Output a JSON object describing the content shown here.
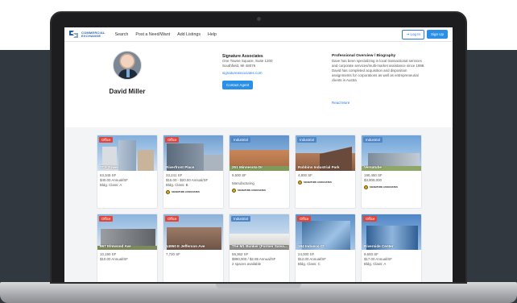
{
  "nav": {
    "logo_line1": "COMMERCIAL",
    "logo_line2": "EXCHANGE",
    "links": [
      "Search",
      "Post a Need/Want",
      "Add Listings",
      "Help"
    ],
    "login_label": "Log In",
    "signup_label": "Sign Up"
  },
  "agent": {
    "name": "David Miller",
    "company": "Signature Associates",
    "address1": "One Towne Square, Suite 1200",
    "address2": "Southfield, MI 48076",
    "website": "signatureassociates.com",
    "contact_label": "Contact Agent"
  },
  "bio": {
    "title": "Professional Overview / Biography",
    "text": "Dave has been specializing in local transactional services and corporate services/multi-market assistance since 1998. David has completed acquisition and disposition assignments for corporations as well as entrepreneurial clients in Austra",
    "read_more": "Read More"
  },
  "listings": [
    {
      "tag": "Office",
      "title": "TCF Tower",
      "lines": [
        "63,345 SF",
        "$40.00 Annual/SF",
        "Bldg. Class: A"
      ],
      "brand": false
    },
    {
      "tag": "Office",
      "title": "Riverfront Place",
      "lines": [
        "33,241 SF",
        "$15.00 - $20.00 Annual/SF",
        "Bldg. Class: B"
      ],
      "brand": true
    },
    {
      "tag": "Industrial",
      "title": "251 Minnesota Dr",
      "lines": [
        "9,500 SF",
        "",
        "Manufacturing"
      ],
      "brand": true
    },
    {
      "tag": "Industrial",
      "title": "Robbins Industrial Park",
      "lines": [
        "4,800 SF"
      ],
      "brand": true
    },
    {
      "tag": "Industrial",
      "title": "Versatube",
      "lines": [
        "190,450 SF",
        "$3,809,000"
      ],
      "brand": true
    },
    {
      "tag": "Office",
      "title": "667 Elmwood Ave",
      "lines": [
        "10,190 SF",
        "$10.00 Annual/SF"
      ],
      "brand": false
    },
    {
      "tag": "Office",
      "title": "14950 E Jefferson Ave",
      "lines": [
        "7,720 SF"
      ],
      "brand": false
    },
    {
      "tag": "Industrial",
      "title": "The M1 Bunker (Former Salva...",
      "lines": [
        "59,362 SF",
        "$990,000 / $2.95 Annual/SF",
        "2 spaces available"
      ],
      "brand": false
    },
    {
      "tag": "Office",
      "title": "184 Indusco Ct",
      "lines": [
        "24,000 SF",
        "$12.00 Annual/SF",
        "Bldg. Class: C"
      ],
      "brand": false
    },
    {
      "tag": "Office",
      "title": "Riverside Center",
      "lines": [
        "9,693 SF",
        "$17.00 Annual/SF",
        "Bldg. Class: A"
      ],
      "brand": false
    }
  ],
  "brand_label": "SIGNATURE ASSOCIATES",
  "colors": {
    "office_tag": "#e0463c",
    "industrial_tag": "#4f86c6",
    "primary_button": "#2a8fe6",
    "background_dark": "#313840"
  }
}
